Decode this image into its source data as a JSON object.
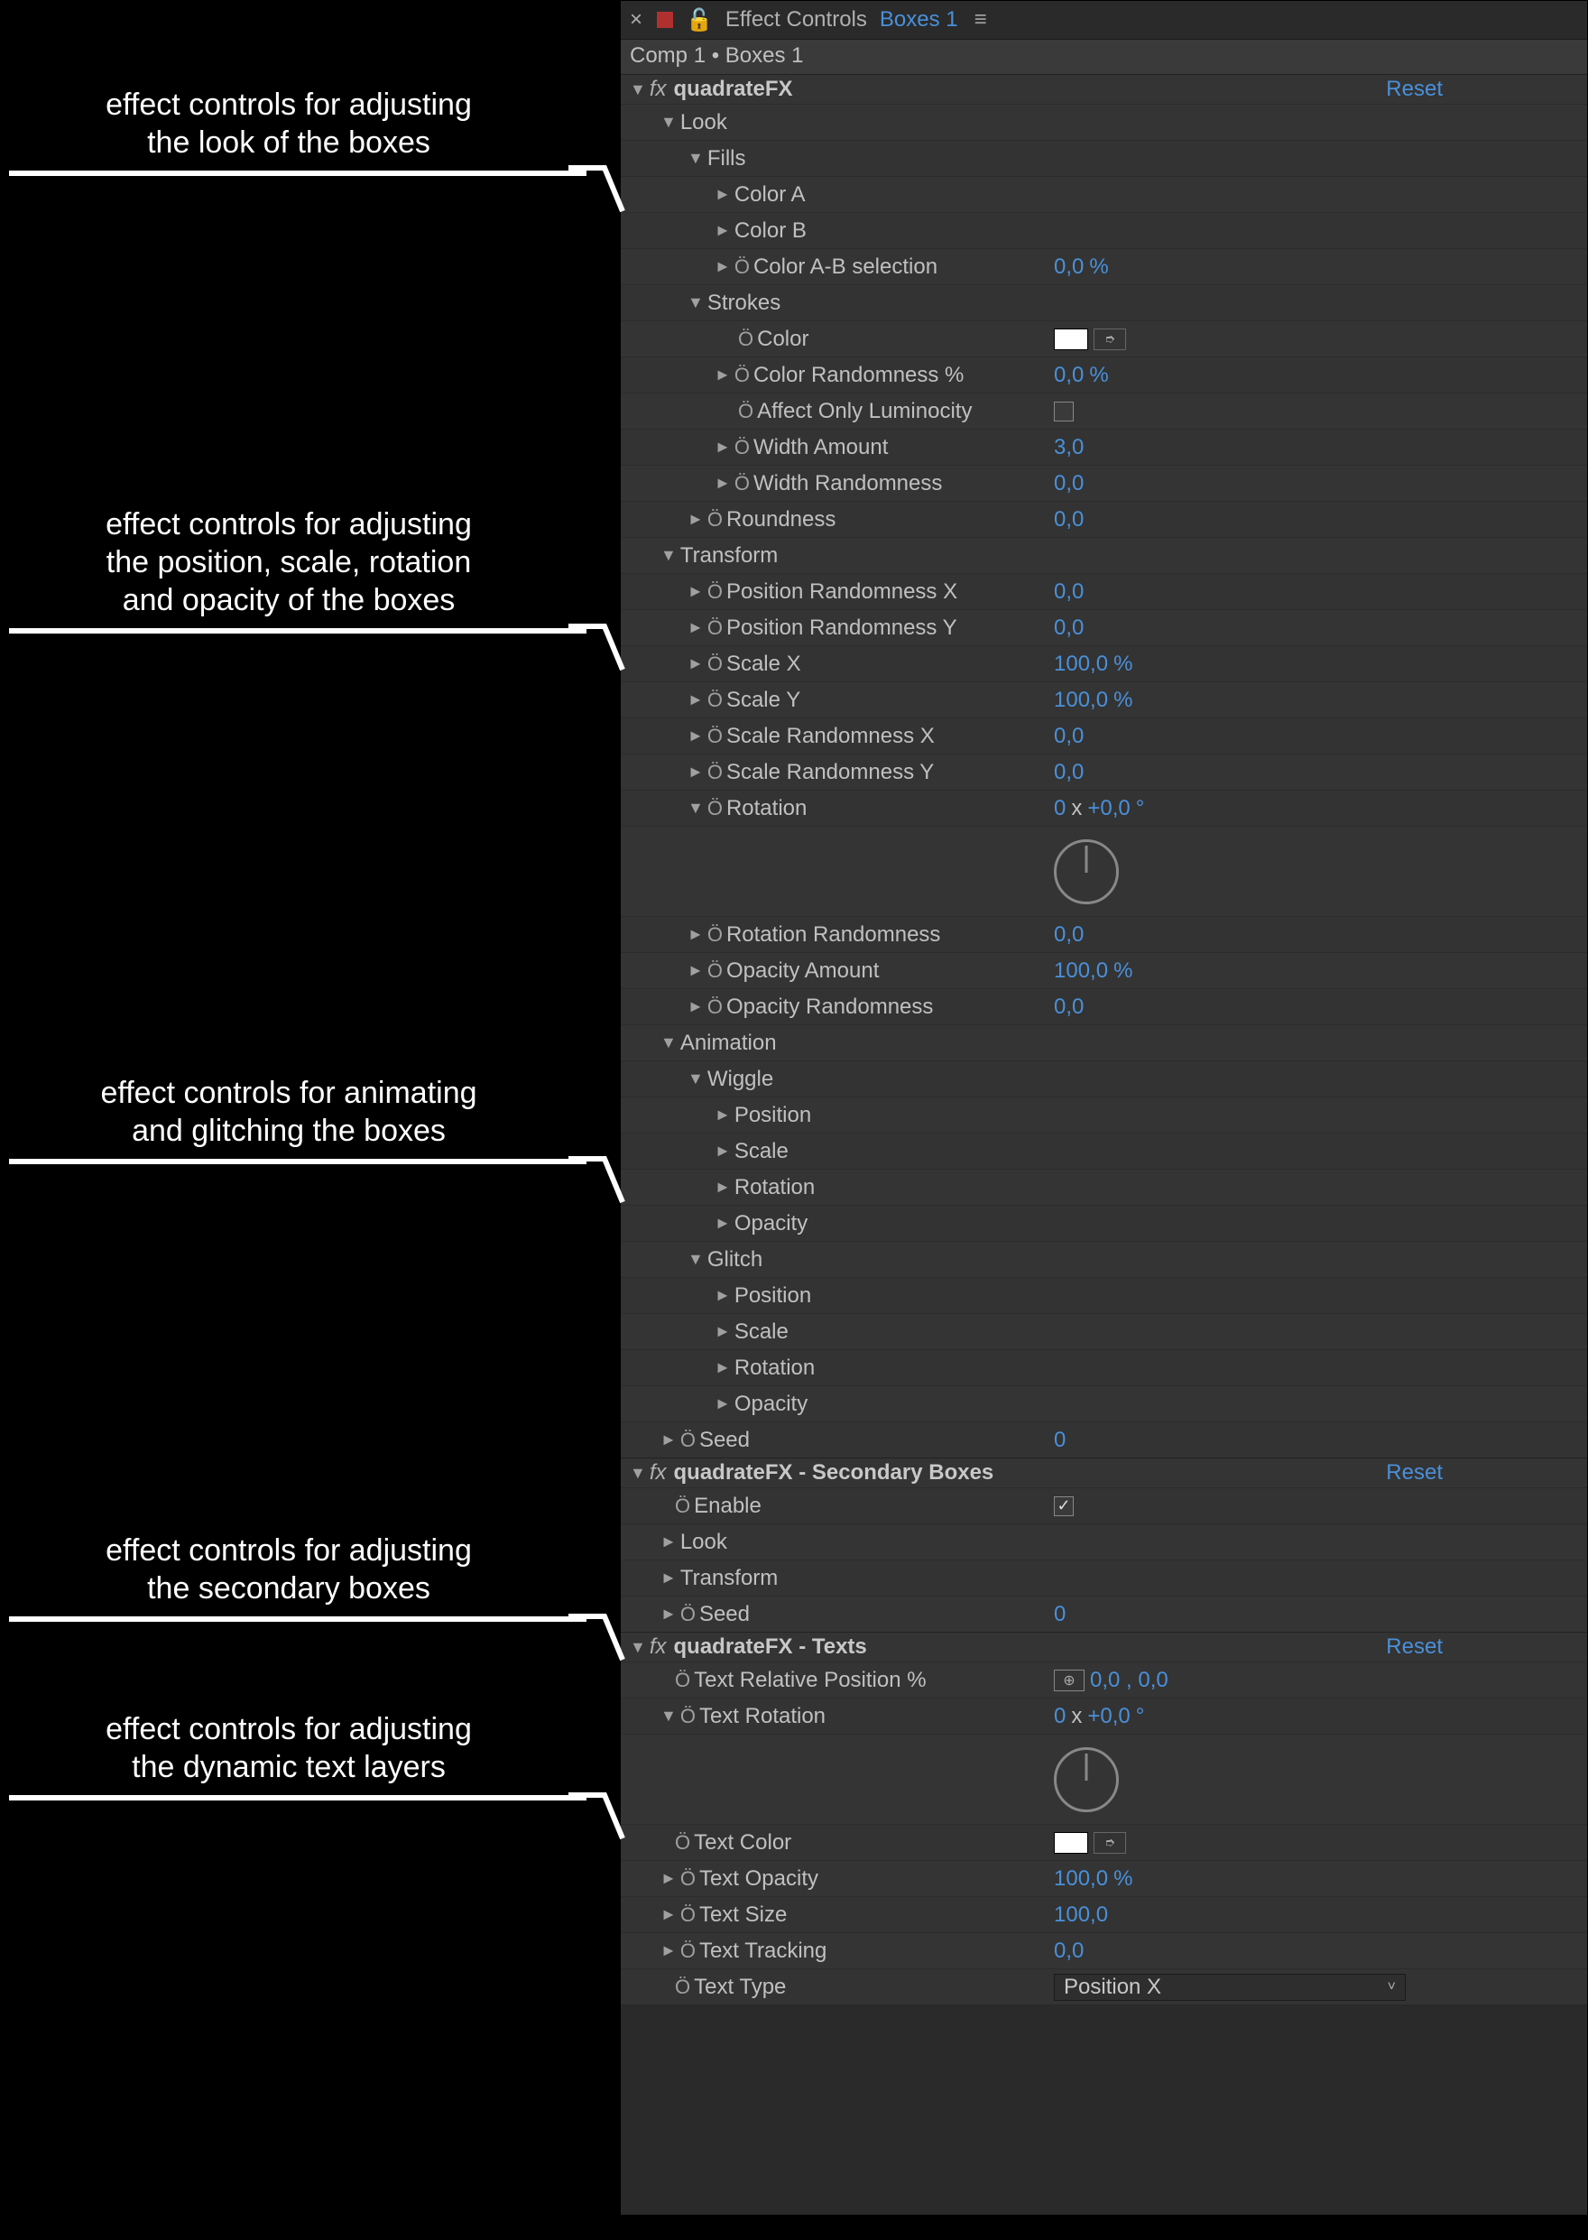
{
  "panel": {
    "close_x": "×",
    "title": "Effect Controls",
    "layer": "Boxes 1",
    "menu_glyph": "≡",
    "lock_glyph": "🔓",
    "crumb": "Comp 1 • Boxes 1"
  },
  "fx1": {
    "name": "quadrateFX",
    "reset": "Reset",
    "look": "Look",
    "fills": "Fills",
    "color_a": "Color A",
    "color_b": "Color B",
    "color_ab_sel": "Color A-B selection",
    "color_ab_sel_v": "0,0",
    "pct": "%",
    "strokes": "Strokes",
    "stroke_color": "Color",
    "stroke_rand": "Color Randomness %",
    "stroke_rand_v": "0,0",
    "affect_lum": "Affect Only Luminocity",
    "affect_lum_v": false,
    "width_amt": "Width Amount",
    "width_amt_v": "3,0",
    "width_rand": "Width Randomness",
    "width_rand_v": "0,0",
    "roundness": "Roundness",
    "roundness_v": "0,0",
    "transform": "Transform",
    "pos_rx": "Position Randomness X",
    "pos_rx_v": "0,0",
    "pos_ry": "Position Randomness Y",
    "pos_ry_v": "0,0",
    "scale_x": "Scale X",
    "scale_x_v": "100,0",
    "scale_y": "Scale Y",
    "scale_y_v": "100,0",
    "scale_rx": "Scale Randomness X",
    "scale_rx_v": "0,0",
    "scale_ry": "Scale Randomness Y",
    "scale_ry_v": "0,0",
    "rotation": "Rotation",
    "rot_turns": "0",
    "rot_x": "x",
    "rot_deg": "+0,0",
    "rot_unit": "°",
    "rot_rand": "Rotation Randomness",
    "rot_rand_v": "0,0",
    "op_amt": "Opacity Amount",
    "op_amt_v": "100,0",
    "op_rand": "Opacity Randomness",
    "op_rand_v": "0,0",
    "animation": "Animation",
    "wiggle": "Wiggle",
    "w_pos": "Position",
    "w_scale": "Scale",
    "w_rot": "Rotation",
    "w_op": "Opacity",
    "glitch": "Glitch",
    "g_pos": "Position",
    "g_scale": "Scale",
    "g_rot": "Rotation",
    "g_op": "Opacity",
    "seed": "Seed",
    "seed_v": "0"
  },
  "fx2": {
    "name": "quadrateFX - Secondary Boxes",
    "reset": "Reset",
    "enable": "Enable",
    "enable_v": true,
    "look": "Look",
    "transform": "Transform",
    "seed": "Seed",
    "seed_v": "0"
  },
  "fx3": {
    "name": "quadrateFX - Texts",
    "reset": "Reset",
    "relpos": "Text Relative Position %",
    "relpos_v": "0,0 , 0,0",
    "trot": "Text Rotation",
    "trot_turns": "0",
    "trot_x": "x",
    "trot_deg": "+0,0",
    "trot_unit": "°",
    "tcolor": "Text Color",
    "top": "Text Opacity",
    "top_v": "100,0",
    "tsize": "Text Size",
    "tsize_v": "100,0",
    "ttrack": "Text Tracking",
    "ttrack_v": "0,0",
    "ttype": "Text Type",
    "ttype_v": "Position X"
  },
  "ann": {
    "a1": "effect controls for adjusting\nthe look of the boxes",
    "a2": "effect controls for adjusting\nthe position, scale, rotation\nand opacity of the boxes",
    "a3": "effect controls for animating\nand glitching the boxes",
    "a4": "effect controls for adjusting\nthe secondary boxes",
    "a5": "effect controls for adjusting\nthe dynamic text layers"
  },
  "icons": {
    "tri_down": "▼",
    "tri_right": "►",
    "stopwatch": "Ö",
    "check": "✓",
    "chev_down": "˅",
    "target": "⊕",
    "eyedrop": "➮"
  }
}
